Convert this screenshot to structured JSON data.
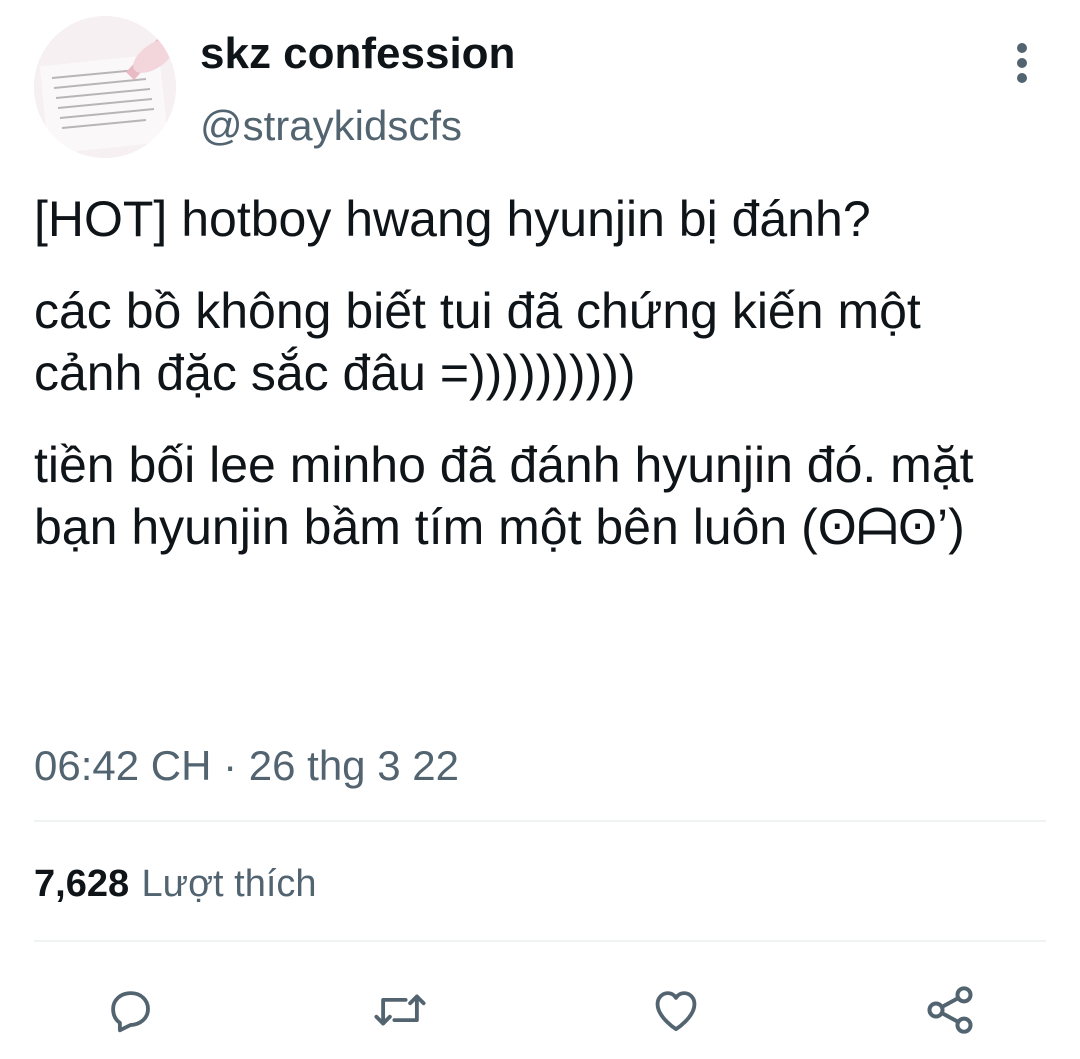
{
  "tweet": {
    "author": {
      "display_name": "skz confession",
      "handle": "@straykidscfs",
      "avatar_icon": "avatar-handwritten-notes"
    },
    "paragraphs": [
      "[HOT] hotboy hwang hyunjin bị đánh?",
      "các bồ không biết tui đã chứng kiến một cảnh đặc sắc đâu =))))))))))",
      "tiền bối lee minho đã đánh hyunjin đó. mặt bạn hyunjin bầm tím một bên luôn (ʘᗩʘ’)"
    ],
    "timestamp": "06:42 CH · 26 thg 3 22",
    "likes": {
      "count": "7,628",
      "label": "Lượt thích"
    }
  },
  "actions": [
    {
      "name": "reply",
      "icon": "reply-icon"
    },
    {
      "name": "retweet",
      "icon": "retweet-icon"
    },
    {
      "name": "like",
      "icon": "heart-icon"
    },
    {
      "name": "share",
      "icon": "share-icon"
    }
  ],
  "colors": {
    "primary_text": "#0f1419",
    "secondary_text": "#536471",
    "divider": "#eff3f4"
  }
}
